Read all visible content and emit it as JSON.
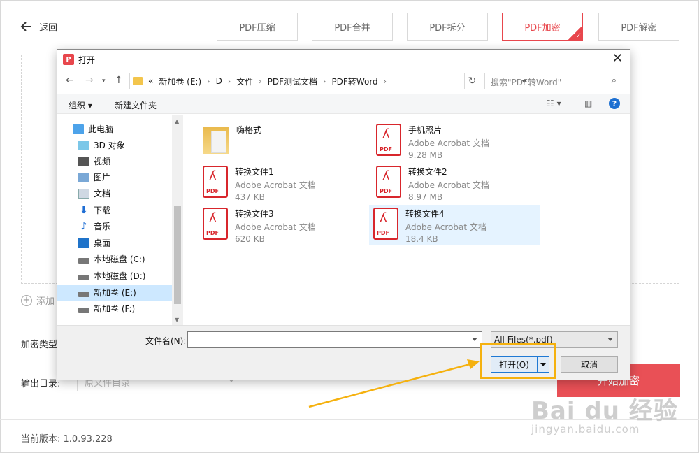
{
  "header": {
    "back_label": "返回",
    "tabs": [
      {
        "label": "PDF压缩",
        "active": false
      },
      {
        "label": "PDF合并",
        "active": false
      },
      {
        "label": "PDF拆分",
        "active": false
      },
      {
        "label": "PDF加密",
        "active": true
      },
      {
        "label": "PDF解密",
        "active": false
      }
    ]
  },
  "main": {
    "add_label": "添加",
    "encrypt_type_label": "加密类型",
    "output_label": "输出目录:",
    "output_value": "原文件目录",
    "start_button": "开始加密",
    "version": "当前版本: 1.0.93.228"
  },
  "dialog": {
    "title": "打开",
    "address": {
      "overflow": "«",
      "crumbs": [
        "新加卷 (E:)",
        "D",
        "文件",
        "PDF测试文档",
        "PDF转Word"
      ]
    },
    "search_placeholder": "搜索\"PDF转Word\"",
    "toolbar": {
      "organize": "组织 ▾",
      "new_folder": "新建文件夹"
    },
    "tree": [
      {
        "label": "此电脑",
        "icon": "computer-icon"
      },
      {
        "label": "3D 对象",
        "icon": "3d-objects-icon"
      },
      {
        "label": "视频",
        "icon": "video-icon"
      },
      {
        "label": "图片",
        "icon": "pictures-icon"
      },
      {
        "label": "文档",
        "icon": "documents-icon"
      },
      {
        "label": "下载",
        "icon": "download-icon"
      },
      {
        "label": "音乐",
        "icon": "music-icon"
      },
      {
        "label": "桌面",
        "icon": "desktop-icon"
      },
      {
        "label": "本地磁盘 (C:)",
        "icon": "drive-icon"
      },
      {
        "label": "本地磁盘 (D:)",
        "icon": "drive-icon"
      },
      {
        "label": "新加卷 (E:)",
        "icon": "drive-icon",
        "selected": true
      },
      {
        "label": "新加卷 (F:)",
        "icon": "drive-icon"
      }
    ],
    "files": [
      {
        "name": "嗨格式",
        "type": "folder"
      },
      {
        "name": "手机照片",
        "type": "Adobe Acrobat 文档",
        "size": "9.28 MB"
      },
      {
        "name": "转换文件1",
        "type": "Adobe Acrobat 文档",
        "size": "437 KB"
      },
      {
        "name": "转换文件2",
        "type": "Adobe Acrobat 文档",
        "size": "8.97 MB"
      },
      {
        "name": "转换文件3",
        "type": "Adobe Acrobat 文档",
        "size": "620 KB"
      },
      {
        "name": "转换文件4",
        "type": "Adobe Acrobat 文档",
        "size": "18.4 KB",
        "selected": true
      }
    ],
    "pdf_badge": "PDF",
    "filename_label": "文件名(N):",
    "filename_value": "",
    "filter_value": "All Files(*.pdf)",
    "open_button": "打开(O)",
    "cancel_button": "取消"
  },
  "watermark": {
    "big": "Bai du 经验",
    "small": "jingyan.baidu.com"
  },
  "colors": {
    "accent": "#e8474d",
    "highlight": "#f5b10e",
    "selection": "#cde8ff"
  }
}
